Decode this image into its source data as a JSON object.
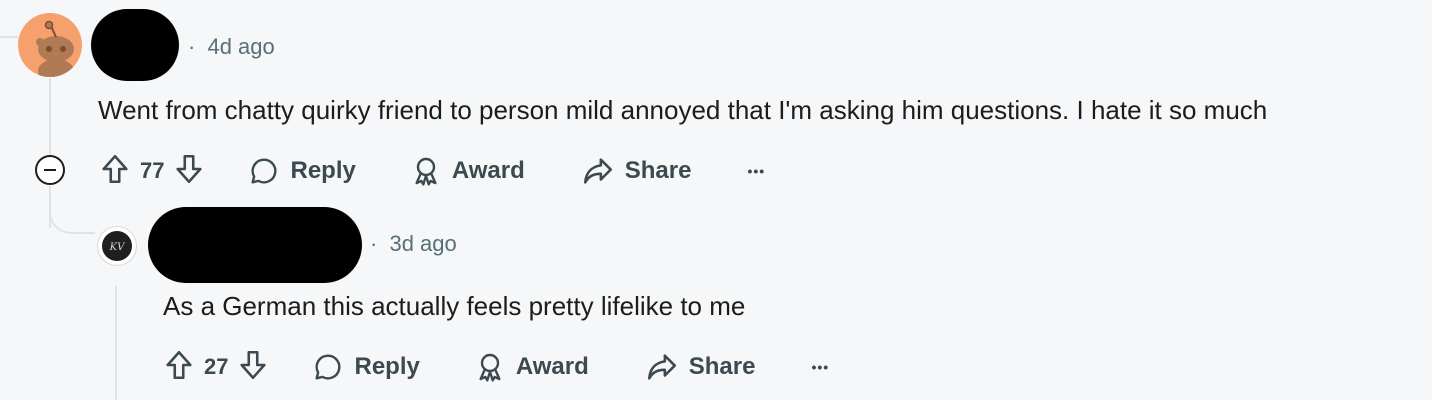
{
  "comments": [
    {
      "timestamp": "4d ago",
      "body": "Went from chatty quirky friend to person mild annoyed that I'm asking him questions. I hate it so much",
      "votes": "77",
      "reply_label": "Reply",
      "award_label": "Award",
      "share_label": "Share",
      "more_label": "•••"
    },
    {
      "timestamp": "3d ago",
      "body": "As a German this actually feels pretty lifelike to me",
      "votes": "27",
      "reply_label": "Reply",
      "award_label": "Award",
      "share_label": "Share",
      "more_label": "•••",
      "avatar_text": "KV"
    }
  ],
  "separator": "·",
  "colors": {
    "background": "#f6f7f8",
    "text": "#1c1c1c",
    "meta": "#576f76",
    "action": "#3c4a50",
    "thread_line": "#dfe3e6",
    "avatar_orange": "#f6a16d"
  }
}
